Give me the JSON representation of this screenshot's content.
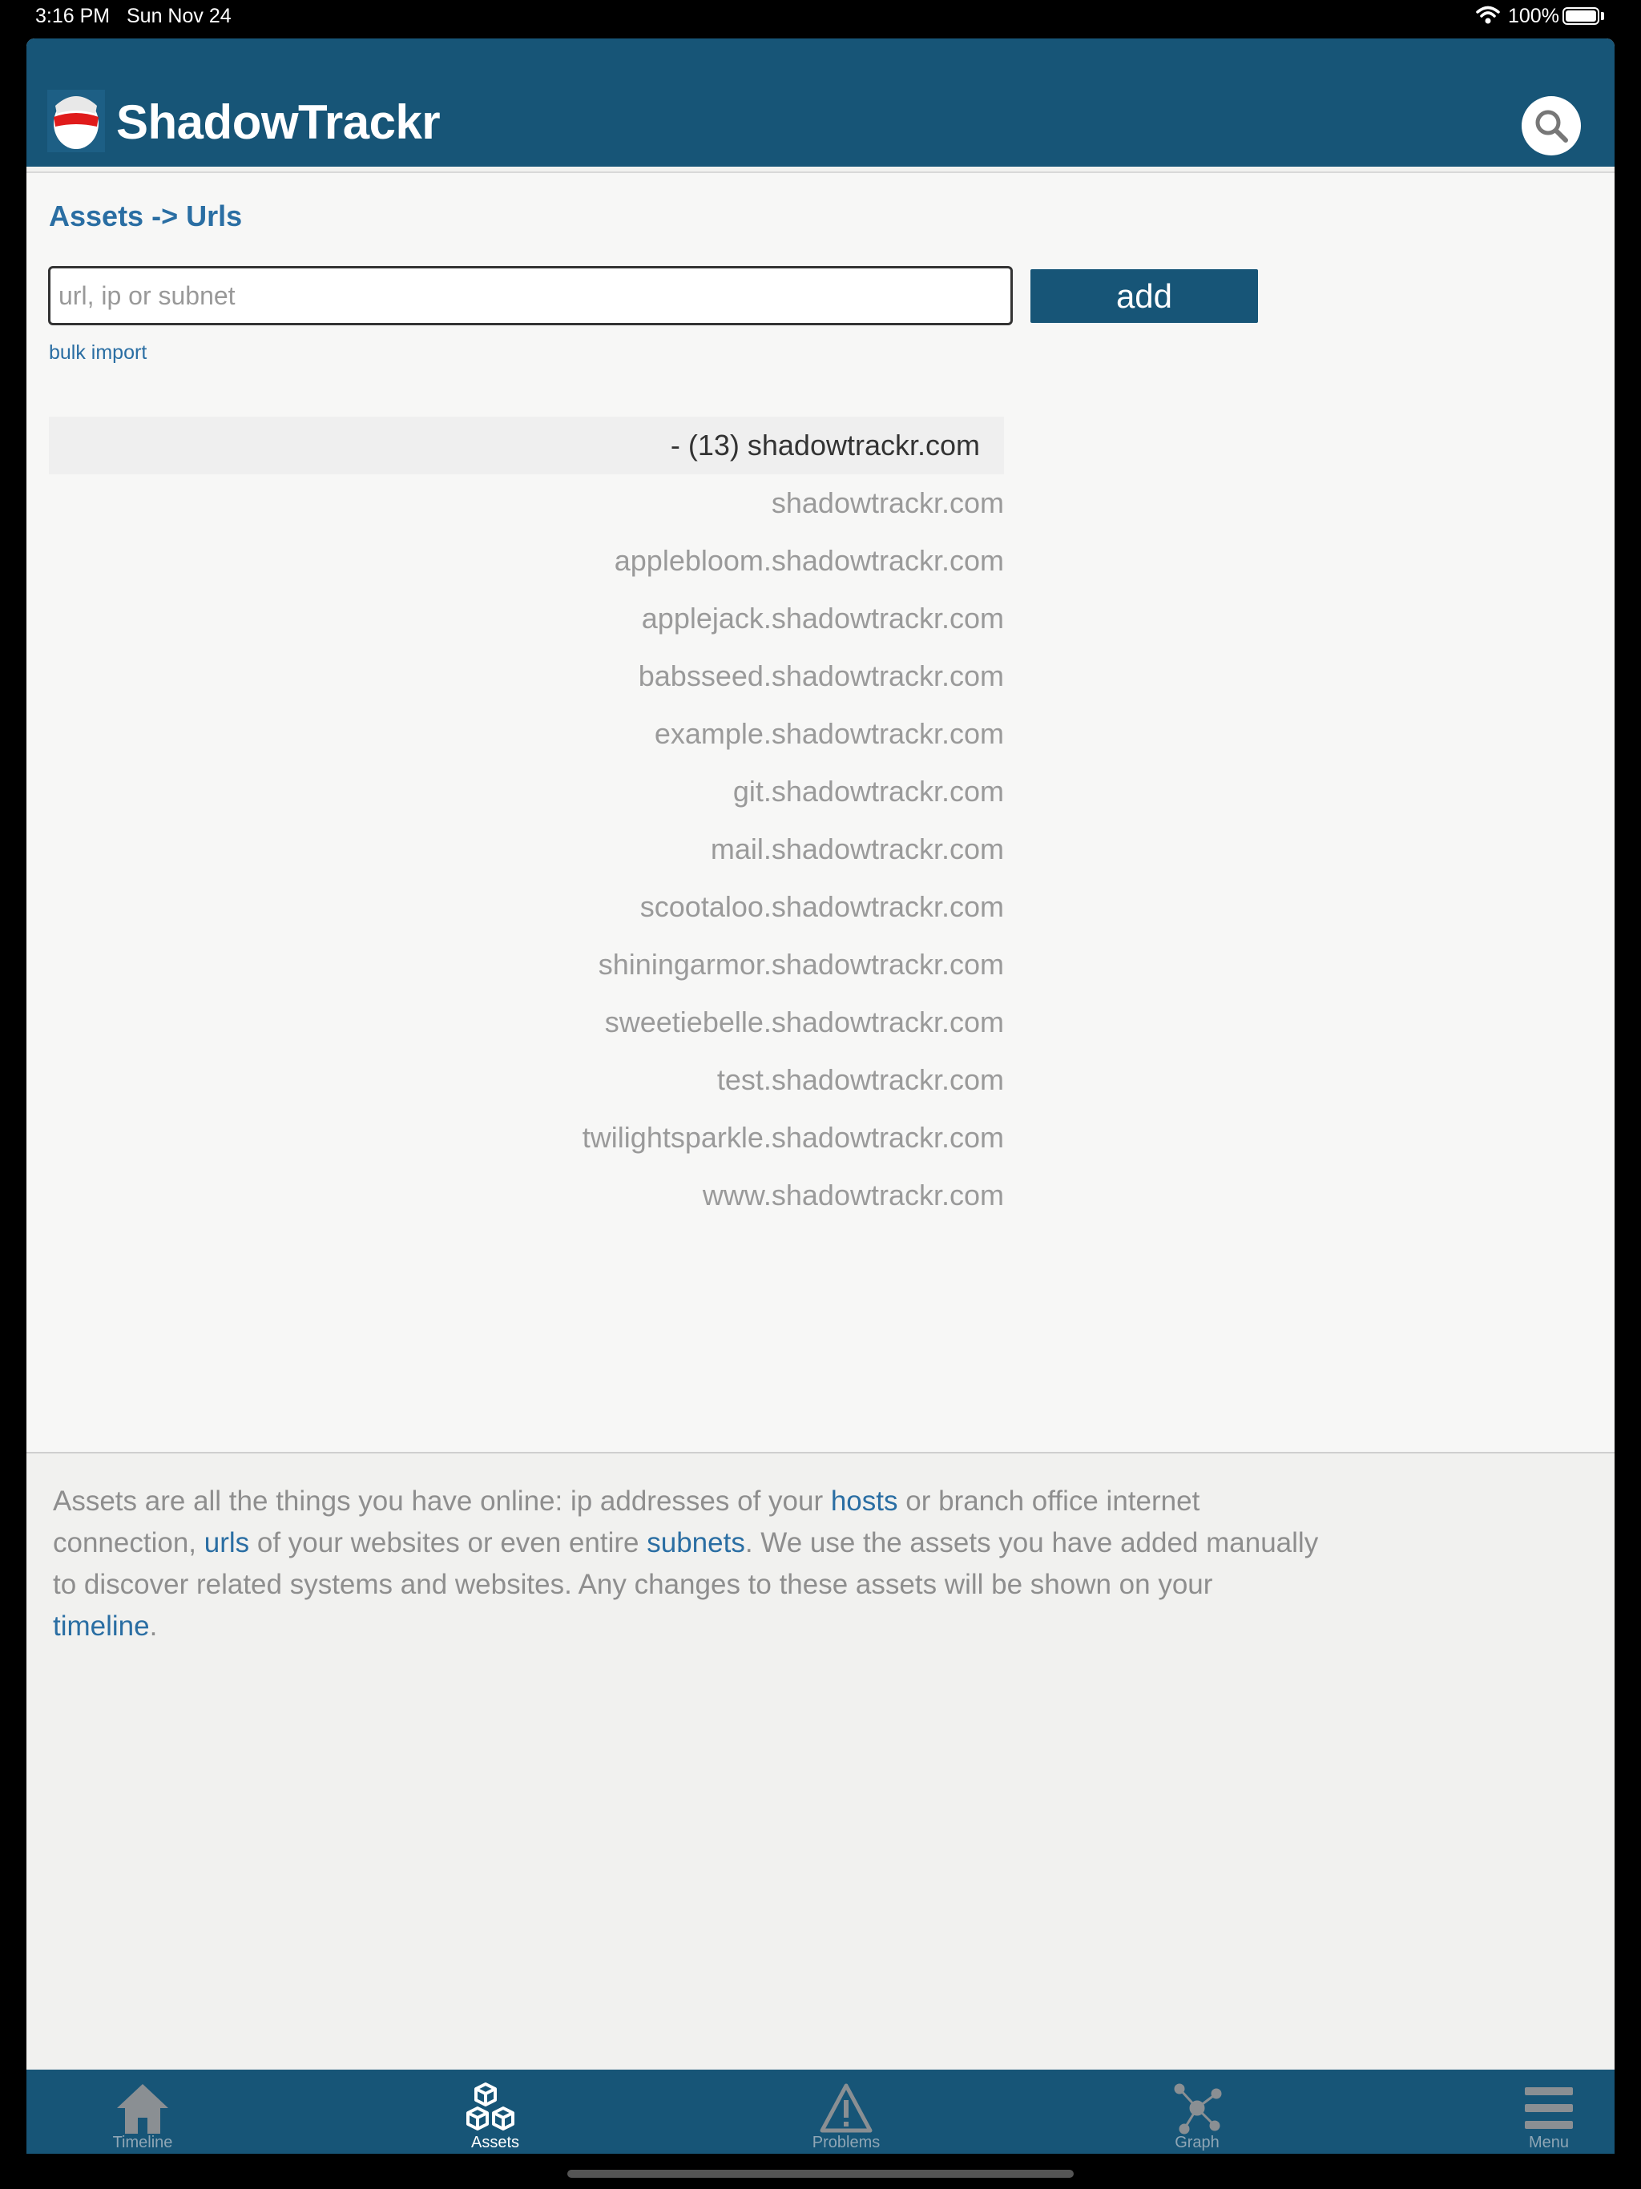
{
  "status_bar": {
    "time": "3:16 PM",
    "date": "Sun Nov 24",
    "battery": "100%"
  },
  "header": {
    "brand": "ShadowTrackr"
  },
  "breadcrumb": "Assets -> Urls",
  "add_form": {
    "placeholder": "url, ip or subnet",
    "button_label": "add",
    "bulk_import": "bulk import"
  },
  "url_group": {
    "header": "- (13) shadowtrackr.com",
    "items": [
      "shadowtrackr.com",
      "applebloom.shadowtrackr.com",
      "applejack.shadowtrackr.com",
      "babsseed.shadowtrackr.com",
      "example.shadowtrackr.com",
      "git.shadowtrackr.com",
      "mail.shadowtrackr.com",
      "scootaloo.shadowtrackr.com",
      "shiningarmor.shadowtrackr.com",
      "sweetiebelle.shadowtrackr.com",
      "test.shadowtrackr.com",
      "twilightsparkle.shadowtrackr.com",
      "www.shadowtrackr.com"
    ]
  },
  "help": {
    "t1": "Assets are all the things you have online: ip addresses of your ",
    "l1": "hosts",
    "t2": " or branch office internet connection, ",
    "l2": "urls",
    "t3": " of your websites or even entire ",
    "l3": "subnets",
    "t4": ". We use the assets you have added manually to discover related systems and websites. Any changes to these assets will be shown on your ",
    "l4": "timeline",
    "t5": "."
  },
  "tabs": [
    {
      "label": "Timeline",
      "icon": "home-icon"
    },
    {
      "label": "Assets",
      "icon": "cubes-icon"
    },
    {
      "label": "Problems",
      "icon": "warning-icon"
    },
    {
      "label": "Graph",
      "icon": "graph-icon"
    },
    {
      "label": "Menu",
      "icon": "menu-icon"
    }
  ],
  "colors": {
    "brand": "#175577",
    "link": "#2a6ea3",
    "muted_text": "#9a9a9a"
  }
}
